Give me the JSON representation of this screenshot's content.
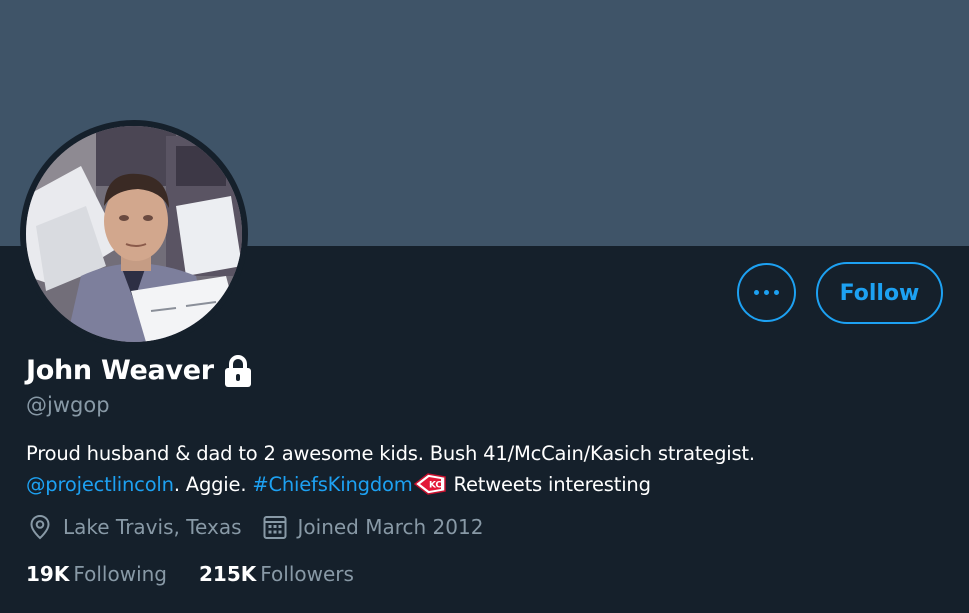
{
  "colors": {
    "banner": "#3f5468",
    "background": "#15202b",
    "accent": "#1da1f2",
    "secondary_text": "#8899a6"
  },
  "profile": {
    "display_name": "John Weaver",
    "protected_icon": "lock-icon",
    "handle": "@jwgop",
    "bio": {
      "line1": "Proud husband & dad to 2 awesome kids. Bush 41/McCain/Kasich strategist.",
      "mention": "@projectlincoln",
      "text_after_mention": ". Aggie. ",
      "hashtag": "#ChiefsKingdom",
      "emoji_icon": "chiefs-logo-icon",
      "text_end": " Retweets interesting"
    },
    "location": "Lake Travis, Texas",
    "location_icon": "location-pin-icon",
    "joined": "Joined March 2012",
    "joined_icon": "calendar-icon"
  },
  "actions": {
    "more_icon": "more-icon",
    "follow_label": "Follow"
  },
  "stats": {
    "following_count": "19K",
    "following_label": "Following",
    "followers_count": "215K",
    "followers_label": "Followers"
  }
}
